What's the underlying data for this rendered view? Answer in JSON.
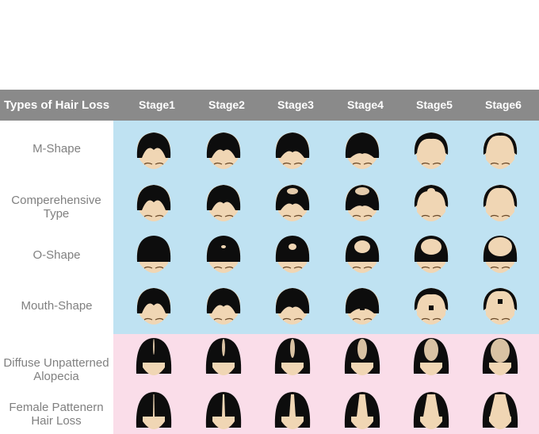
{
  "header": {
    "title": "Types of Hair Loss",
    "stages": [
      "Stage1",
      "Stage2",
      "Stage3",
      "Stage4",
      "Stage5",
      "Stage6"
    ]
  },
  "rows": [
    {
      "label": "M-Shape",
      "group": "male"
    },
    {
      "label": "Comperehensive Type",
      "group": "male"
    },
    {
      "label": "O-Shape",
      "group": "male"
    },
    {
      "label": "Mouth-Shape",
      "group": "male"
    },
    {
      "label": "Diffuse Unpatterned Alopecia",
      "group": "female"
    },
    {
      "label": "Female Pattenern Hair Loss",
      "group": "female"
    }
  ],
  "colors": {
    "header_bg": "#8a8a8a",
    "male_bg": "#bfe2f2",
    "female_bg": "#fadde9",
    "hair": "#0d0d0d",
    "skin": "#f0d6b4",
    "label_text": "#808080"
  },
  "icons": [
    "head-icon"
  ]
}
